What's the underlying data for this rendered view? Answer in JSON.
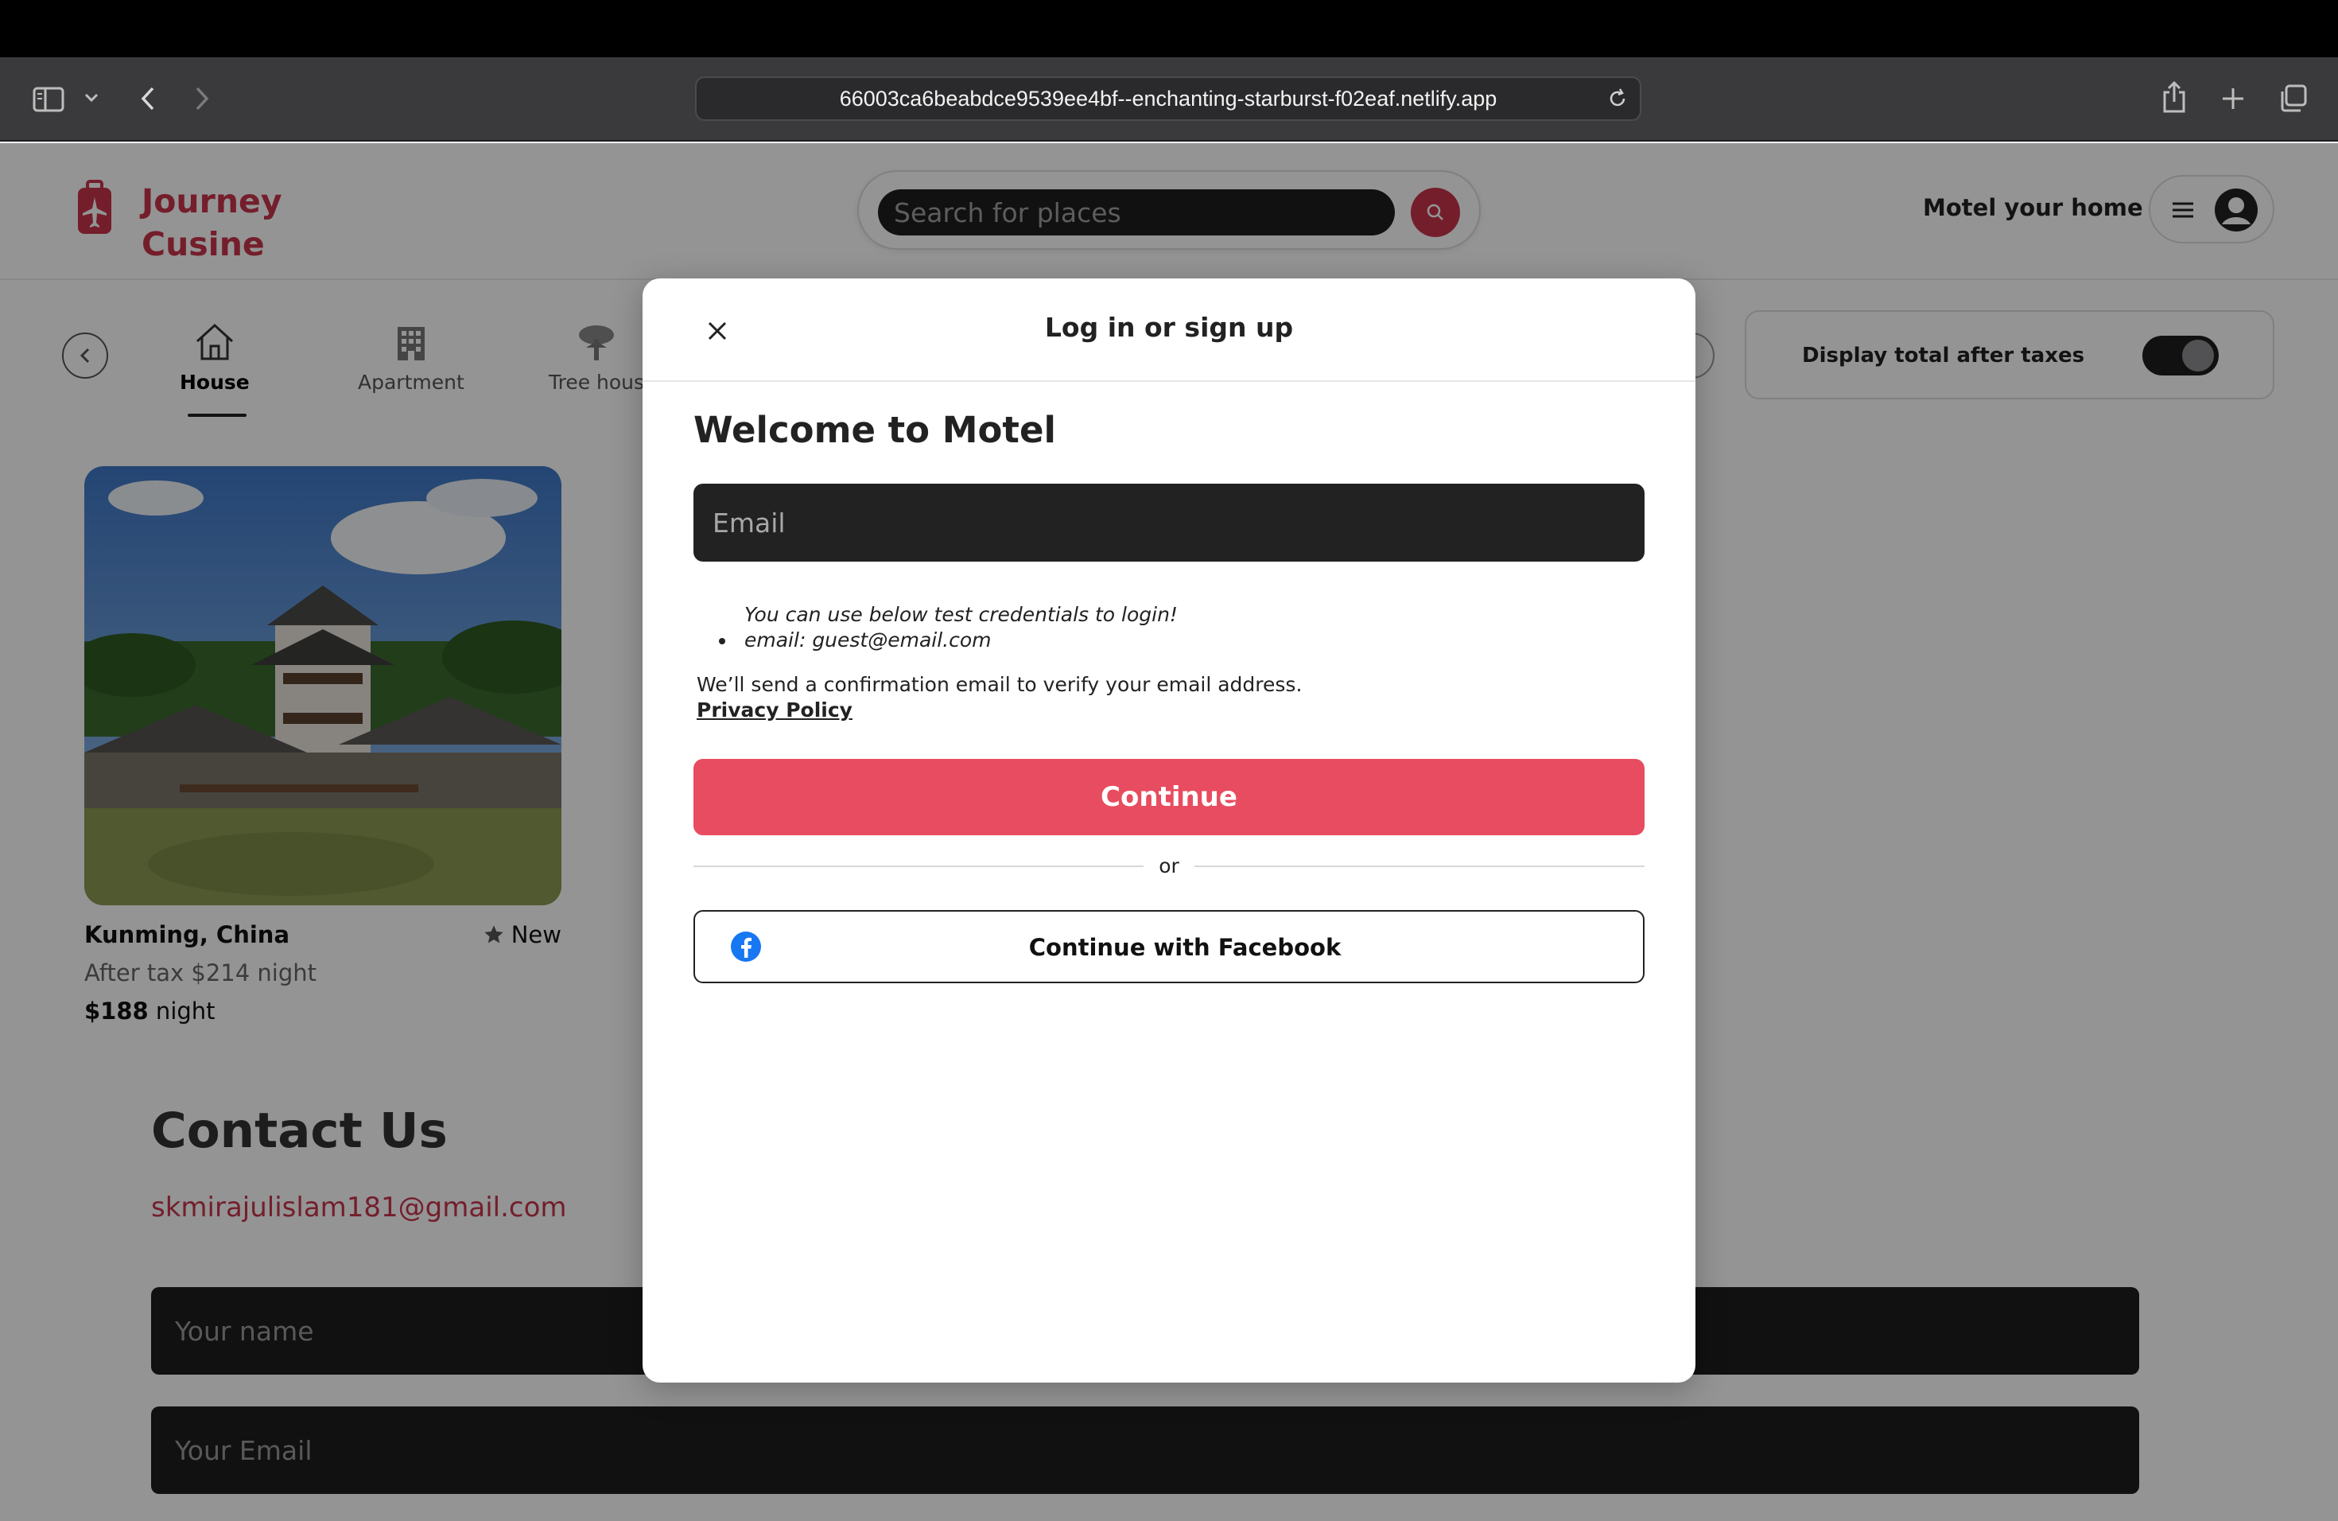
{
  "browser": {
    "url": "66003ca6beabdce9539ee4bf--enchanting-starburst-f02eaf.netlify.app"
  },
  "header": {
    "logo_line1": "Journey",
    "logo_line2": "Cusine",
    "search_placeholder": "Search for places",
    "host_link": "Motel your home"
  },
  "categories": {
    "items": [
      {
        "label": "House",
        "icon": "house-icon",
        "active": true
      },
      {
        "label": "Apartment",
        "icon": "building-icon",
        "active": false
      },
      {
        "label": "Tree hous",
        "icon": "tree-icon",
        "active": false
      }
    ],
    "tax_toggle_label": "Display total after taxes",
    "tax_toggle_on": true
  },
  "listing": {
    "location": "Kunming, China",
    "rating_label": "New",
    "after_tax": "After tax $214 night",
    "price": "$188",
    "price_suffix": " night"
  },
  "contact": {
    "title": "Contact Us",
    "email": "skmirajulislam181@gmail.com",
    "name_placeholder": "Your name",
    "email_placeholder": "Your Email"
  },
  "modal": {
    "title": "Log in or sign up",
    "welcome": "Welcome to Motel",
    "email_placeholder": "Email",
    "hint_line1": "You can use below test credentials to login!",
    "hint_line2": "email: guest@email.com",
    "confirm_text": "We’ll send a confirmation email to verify your email address.",
    "privacy_link": "Privacy Policy",
    "continue_label": "Continue",
    "divider_text": "or",
    "facebook_label": "Continue with Facebook"
  },
  "colors": {
    "brand": "#c8354d",
    "continue_button": "#e84c60",
    "facebook": "#1877f2"
  }
}
